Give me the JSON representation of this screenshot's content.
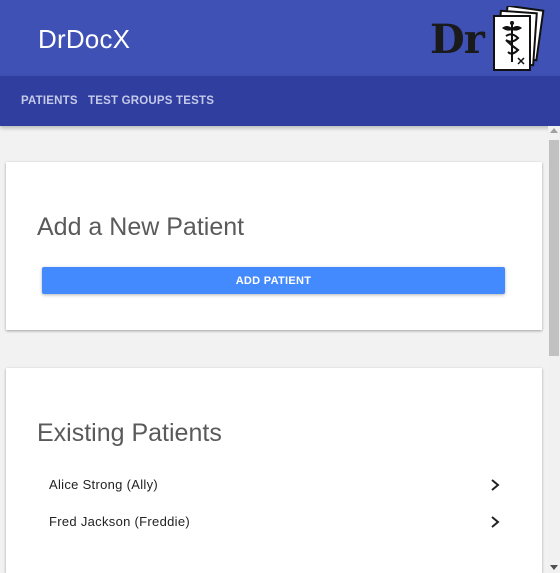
{
  "app": {
    "title": "DrDocX",
    "logo_text": "Dr"
  },
  "nav": {
    "items": [
      {
        "label": "PATIENTS"
      },
      {
        "label": "TEST GROUPS"
      },
      {
        "label": "TESTS"
      }
    ]
  },
  "add_section": {
    "title": "Add a New Patient",
    "button_label": "ADD PATIENT"
  },
  "existing_section": {
    "title": "Existing Patients",
    "patients": [
      {
        "name": "Alice Strong (Ally)",
        "icon": "chevron-right-icon"
      },
      {
        "name": "Fred Jackson (Freddie)",
        "icon": "chevron-right-icon"
      }
    ]
  },
  "colors": {
    "header": "#3f51b5",
    "nav": "#303f9f",
    "button": "#448aff",
    "background": "#f2f2f2"
  }
}
